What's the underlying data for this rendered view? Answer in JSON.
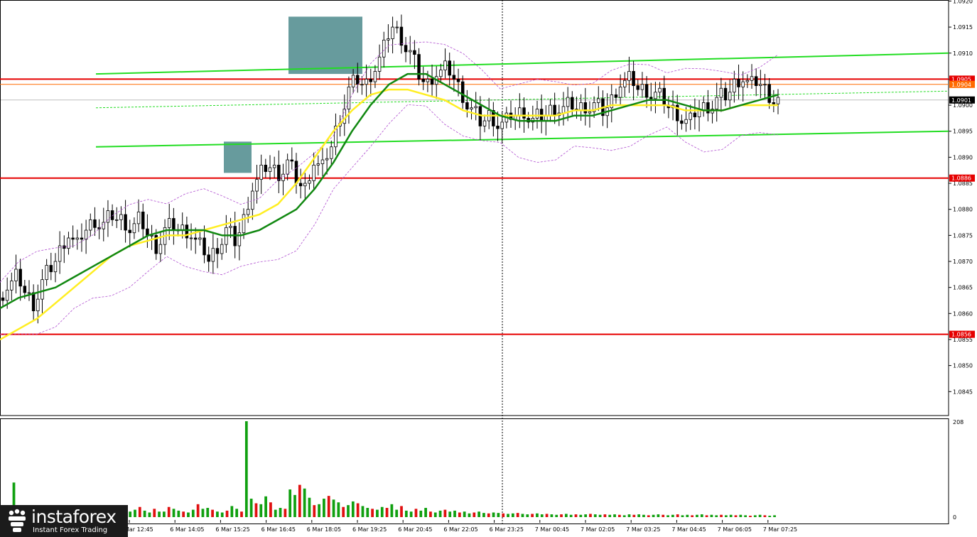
{
  "chart_data": {
    "type": "candlestick",
    "y_ticks": [
      "1.0920",
      "1.0915",
      "1.0910",
      "1.0905",
      "1.0900",
      "1.0895",
      "1.0890",
      "1.0885",
      "1.0880",
      "1.0875",
      "1.0870",
      "1.0865",
      "1.0860",
      "1.0855",
      "1.0850",
      "1.0845"
    ],
    "y_range": [
      1.08404,
      1.09202
    ],
    "x_labels": [
      "Mar 12:45",
      "6 Mar 14:05",
      "6 Mar 15:25",
      "6 Mar 16:45",
      "6 Mar 18:05",
      "6 Mar 19:25",
      "6 Mar 20:45",
      "6 Mar 22:05",
      "6 Mar 23:25",
      "7 Mar 00:45",
      "7 Mar 02:05",
      "7 Mar 03:25",
      "7 Mar 04:45",
      "7 Mar 06:05",
      "7 Mar 07:25"
    ],
    "levels": [
      {
        "label": "1.0905",
        "value": 1.0905,
        "color": "#e60000"
      },
      {
        "label": "1.0886",
        "value": 1.0886,
        "color": "#e60000"
      },
      {
        "label": "1.0856",
        "value": 1.0856,
        "color": "#e60000"
      }
    ],
    "price_tags": [
      {
        "label": "1.0904",
        "value": 1.0904,
        "color": "#ff6a00"
      },
      {
        "label": "1.0901",
        "value": 1.0901,
        "color": "#000000"
      }
    ],
    "channel": {
      "color": "#22dd22",
      "upper": {
        "from": [
          1.0906,
          0
        ],
        "to": [
          1.091,
          1
        ]
      },
      "lower": {
        "from": [
          1.0892,
          0
        ],
        "to": [
          1.0895,
          1
        ]
      }
    },
    "signal_zones": [
      {
        "name": "zone-1",
        "high": 1.0893,
        "low": 1.0887
      },
      {
        "name": "zone-2",
        "high": 1.0917,
        "low": 1.0906
      }
    ],
    "close": [
      1.0865,
      1.0867,
      1.0864,
      1.0862,
      1.0866,
      1.0869,
      1.0872,
      1.0875,
      1.0873,
      1.0876,
      1.0878,
      1.0877,
      1.0879,
      1.0878,
      1.0876,
      1.0878,
      1.0875,
      1.0873,
      1.0876,
      1.0877,
      1.0876,
      1.0875,
      1.0873,
      1.087,
      1.0873,
      1.0876,
      1.0874,
      1.0878,
      1.0884,
      1.0887,
      1.0888,
      1.0887,
      1.0889,
      1.0886,
      1.0884,
      1.0889,
      1.0888,
      1.0892,
      1.0898,
      1.0903,
      1.0905,
      1.0904,
      1.0907,
      1.0911,
      1.0915,
      1.0913,
      1.091,
      1.0906,
      1.0904,
      1.0906,
      1.0907,
      1.0905,
      1.0902,
      1.0899,
      1.0897,
      1.0898,
      1.0896,
      1.0897,
      1.0898,
      1.0899,
      1.0897,
      1.0898,
      1.0899,
      1.0899,
      1.09,
      1.0899,
      1.09,
      1.09,
      1.0899,
      1.0901,
      1.0904,
      1.0905,
      1.0903,
      1.0903,
      1.0902,
      1.0901,
      1.0899,
      1.0897,
      1.0897,
      1.0899,
      1.09,
      1.0901,
      1.0902,
      1.0904,
      1.0905,
      1.0904,
      1.0904,
      1.0902,
      1.0901
    ],
    "ma_green": [
      1.0861,
      1.0863,
      1.0864,
      1.0865,
      1.0867,
      1.0869,
      1.0871,
      1.0873,
      1.0875,
      1.0876,
      1.0876,
      1.0876,
      1.0875,
      1.0875,
      1.0876,
      1.0878,
      1.088,
      1.0884,
      1.0889,
      1.0895,
      1.09,
      1.0904,
      1.0906,
      1.0906,
      1.0904,
      1.0902,
      1.09,
      1.0898,
      1.0897,
      1.0897,
      1.0897,
      1.0898,
      1.0898,
      1.0899,
      1.09,
      1.0901,
      1.0901,
      1.09,
      1.0899,
      1.0899,
      1.09,
      1.0901,
      1.0902
    ],
    "ma_yellow": [
      1.0855,
      1.0857,
      1.0859,
      1.0862,
      1.0865,
      1.0868,
      1.0871,
      1.0873,
      1.0874,
      1.0875,
      1.0875,
      1.0876,
      1.0877,
      1.0878,
      1.0879,
      1.0881,
      1.0885,
      1.089,
      1.0895,
      1.0899,
      1.0902,
      1.0903,
      1.0903,
      1.0902,
      1.0901,
      1.0899,
      1.0898,
      1.0898,
      1.0898,
      1.0898,
      1.0898,
      1.0899,
      1.0899,
      1.09,
      1.09,
      1.09,
      1.09,
      1.0899,
      1.0899,
      1.0899,
      1.09,
      1.09,
      1.09
    ],
    "volume": {
      "scale_labels": [
        "208",
        "0"
      ],
      "max": 208,
      "values": [
        14,
        18,
        75,
        12,
        10,
        9,
        8,
        10,
        12,
        9,
        8,
        22,
        14,
        10,
        12,
        9,
        16,
        10,
        24,
        14,
        10,
        20,
        12,
        9,
        14,
        10,
        12,
        16,
        22,
        14,
        10,
        18,
        12,
        12,
        22,
        18,
        14,
        12,
        10,
        16,
        28,
        18,
        20,
        16,
        12,
        10,
        14,
        24,
        18,
        12,
        208,
        40,
        30,
        28,
        45,
        32,
        16,
        20,
        18,
        60,
        48,
        70,
        62,
        42,
        26,
        28,
        40,
        46,
        38,
        32,
        22,
        26,
        34,
        30,
        24,
        20,
        18,
        16,
        22,
        20,
        28,
        16,
        24,
        14,
        12,
        18,
        14,
        20,
        12,
        10,
        14,
        16,
        12,
        14,
        10,
        12,
        8,
        10,
        12,
        9,
        8,
        10,
        9,
        8,
        7,
        8,
        9,
        7,
        6,
        7,
        8,
        6,
        7,
        6,
        5,
        6,
        7,
        5,
        6,
        5,
        6,
        7,
        6,
        5,
        6,
        5,
        6,
        5,
        4,
        6,
        5,
        6,
        5,
        4,
        5,
        6,
        5,
        4,
        5,
        6,
        4,
        5,
        4,
        5,
        6,
        4,
        5,
        4,
        5,
        4,
        5,
        4,
        5,
        4,
        3,
        4,
        5,
        4,
        3,
        4
      ]
    }
  },
  "logo": {
    "brand": "instaforex",
    "tagline": "Instant Forex Trading"
  }
}
